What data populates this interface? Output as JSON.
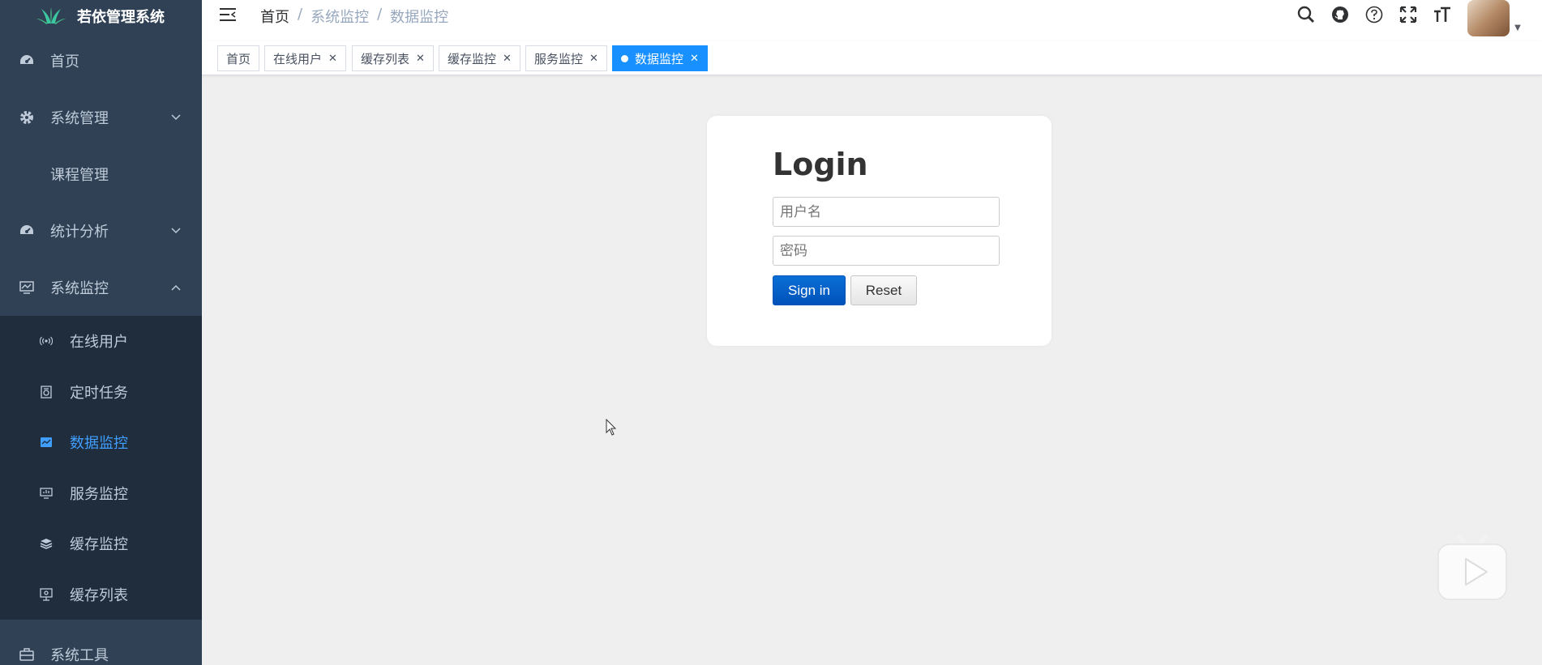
{
  "app": {
    "title": "若依管理系统"
  },
  "sidebar": {
    "items": [
      {
        "label": "首页",
        "icon": "dashboard-icon"
      },
      {
        "label": "系统管理",
        "icon": "gear-icon"
      },
      {
        "label": "课程管理"
      },
      {
        "label": "统计分析",
        "icon": "dashboard-icon"
      },
      {
        "label": "系统监控",
        "icon": "monitor-icon"
      },
      {
        "label": "系统工具",
        "icon": "toolbox-icon"
      }
    ],
    "monitor_children": [
      {
        "label": "在线用户",
        "icon": "online-icon"
      },
      {
        "label": "定时任务",
        "icon": "job-icon"
      },
      {
        "label": "数据监控",
        "icon": "druid-icon"
      },
      {
        "label": "服务监控",
        "icon": "server-icon"
      },
      {
        "label": "缓存监控",
        "icon": "redis-icon"
      },
      {
        "label": "缓存列表",
        "icon": "redis-list-icon"
      }
    ]
  },
  "breadcrumb": {
    "items": [
      "首页",
      "系统监控",
      "数据监控"
    ]
  },
  "tags": [
    {
      "label": "首页"
    },
    {
      "label": "在线用户"
    },
    {
      "label": "缓存列表"
    },
    {
      "label": "缓存监控"
    },
    {
      "label": "服务监控"
    },
    {
      "label": "数据监控"
    }
  ],
  "login": {
    "title": "Login",
    "username_placeholder": "用户名",
    "password_placeholder": "密码",
    "signin_label": "Sign in",
    "reset_label": "Reset"
  },
  "colors": {
    "sidebar_bg": "#304156",
    "submenu_bg": "#1f2d3d",
    "active": "#409eff",
    "tag_active": "#1890ff"
  }
}
